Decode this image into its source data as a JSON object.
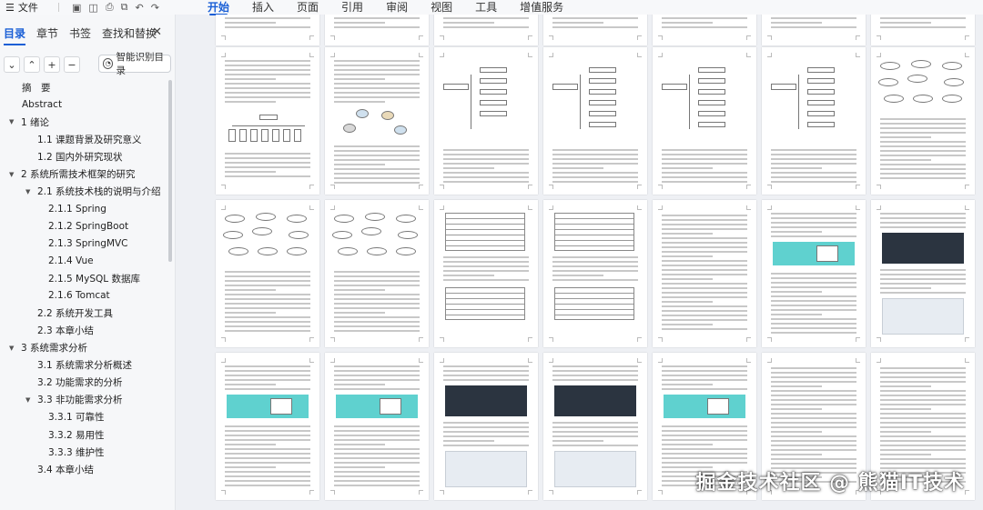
{
  "toolbar": {
    "file_label": "文件",
    "tabs": [
      {
        "label": "开始",
        "active": true
      },
      {
        "label": "插入"
      },
      {
        "label": "页面"
      },
      {
        "label": "引用"
      },
      {
        "label": "审阅"
      },
      {
        "label": "视图"
      },
      {
        "label": "工具"
      },
      {
        "label": "增值服务"
      }
    ],
    "icons": [
      "menu-icon",
      "save-icon",
      "print-preview-icon",
      "print-icon",
      "copy-format-icon",
      "undo-icon",
      "redo-icon",
      "search-icon"
    ]
  },
  "nav_panel": {
    "tabs": [
      {
        "label": "目录",
        "active": true
      },
      {
        "label": "章节"
      },
      {
        "label": "书签"
      },
      {
        "label": "查找和替换"
      }
    ],
    "close_symbol": "✕",
    "tool_buttons": [
      "⌄",
      "⌃",
      "+",
      "−"
    ],
    "ai_button_label": "智能识别目录",
    "toc": [
      {
        "label": "摘　要",
        "level": 1,
        "arrow": false
      },
      {
        "label": "Abstract",
        "level": 1,
        "arrow": false
      },
      {
        "label": "1  绪论",
        "level": 1,
        "arrow": true
      },
      {
        "label": "1.1  课题背景及研究意义",
        "level": 2,
        "arrow": false
      },
      {
        "label": "1.2  国内外研究现状",
        "level": 2,
        "arrow": false
      },
      {
        "label": "2  系统所需技术框架的研究",
        "level": 1,
        "arrow": true
      },
      {
        "label": "2.1  系统技术栈的说明与介绍",
        "level": 2,
        "arrow": true
      },
      {
        "label": "2.1.1 Spring",
        "level": 3,
        "arrow": false
      },
      {
        "label": "2.1.2 SpringBoot",
        "level": 3,
        "arrow": false
      },
      {
        "label": "2.1.3 SpringMVC",
        "level": 3,
        "arrow": false
      },
      {
        "label": "2.1.4 Vue",
        "level": 3,
        "arrow": false
      },
      {
        "label": "2.1.5 MySQL 数据库",
        "level": 3,
        "arrow": false
      },
      {
        "label": "2.1.6 Tomcat",
        "level": 3,
        "arrow": false
      },
      {
        "label": "2.2  系统开发工具",
        "level": 2,
        "arrow": false
      },
      {
        "label": "2.3  本章小结",
        "level": 2,
        "arrow": false
      },
      {
        "label": "3  系统需求分析",
        "level": 1,
        "arrow": true
      },
      {
        "label": "3.1  系统需求分析概述",
        "level": 2,
        "arrow": false
      },
      {
        "label": "3.2  功能需求的分析",
        "level": 2,
        "arrow": false
      },
      {
        "label": "3.3  非功能需求分析",
        "level": 2,
        "arrow": true
      },
      {
        "label": "3.3.1  可靠性",
        "level": 3,
        "arrow": false
      },
      {
        "label": "3.3.2  易用性",
        "level": 3,
        "arrow": false
      },
      {
        "label": "3.3.3  维护性",
        "level": 3,
        "arrow": false
      },
      {
        "label": "3.4  本章小结",
        "level": 2,
        "arrow": false
      }
    ]
  },
  "watermark": "掘金技术社区 @ 熊猫IT技术",
  "colors": {
    "accent": "#1a5fd6",
    "nav_bg": "#f6f7f9",
    "canvas_bg": "#eef0f4"
  }
}
